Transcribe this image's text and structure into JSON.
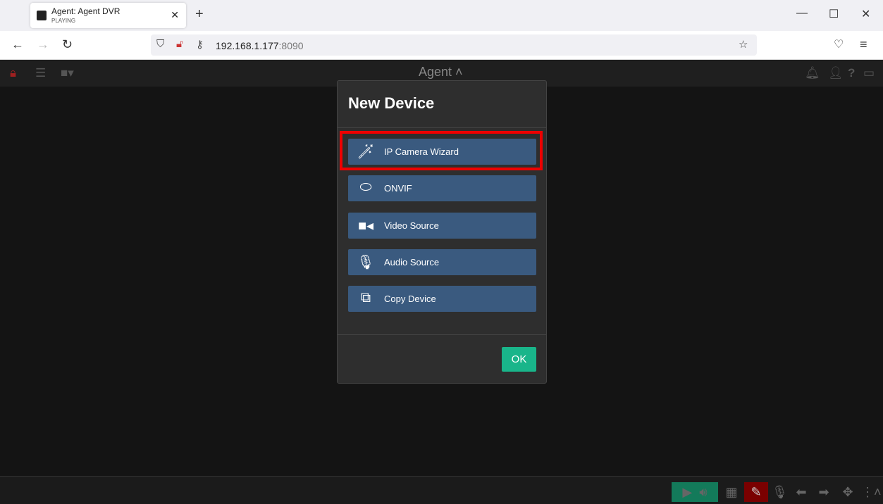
{
  "browser": {
    "tab_title": "Agent: Agent DVR",
    "tab_status": "PLAYING",
    "url_host": "192.168.1.177",
    "url_port": ":8090"
  },
  "app": {
    "title": "Agent"
  },
  "dialog": {
    "title": "New Device",
    "items": [
      {
        "label": "IP Camera Wizard",
        "icon": "magic-wand-icon"
      },
      {
        "label": "ONVIF",
        "icon": "onvif-icon"
      },
      {
        "label": "Video Source",
        "icon": "video-camera-icon"
      },
      {
        "label": "Audio Source",
        "icon": "microphone-icon"
      },
      {
        "label": "Copy Device",
        "icon": "copy-icon"
      }
    ],
    "ok_label": "OK"
  },
  "colors": {
    "item_bg": "#3a5a7f",
    "ok": "#19b58a",
    "highlight": "#e00000",
    "play_group": "#137a5a",
    "edit": "#7a0000"
  }
}
